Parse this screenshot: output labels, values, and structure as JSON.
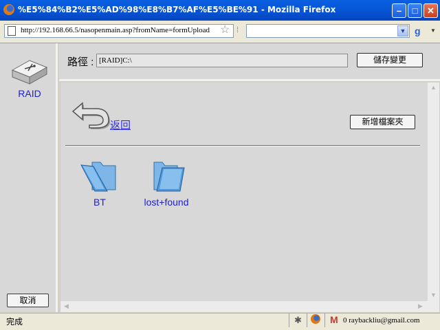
{
  "window": {
    "title": "%E5%84%B2%E5%AD%98%E8%B7%AF%E5%BE%91 - Mozilla Firefox",
    "minimize": "–",
    "maximize": "□",
    "close": "✕"
  },
  "nav": {
    "url": "http://192.168.66.5/nasopenmain.asp?fromName=formUpload"
  },
  "sidebar": {
    "drive_label": "RAID",
    "cancel_label": "取消"
  },
  "toolbar": {
    "path_label": "路徑 :",
    "path_value": "[RAID]C:\\",
    "save_label": "儲存變更"
  },
  "content": {
    "back_label": "返回",
    "new_folder_label": "新增檔案夾",
    "folders": [
      {
        "name": "BT"
      },
      {
        "name": "lost+found"
      }
    ]
  },
  "status": {
    "text": "完成",
    "gmail": "0 raybackliu@gmail.com"
  },
  "colors": {
    "titlebar": "#0758d8",
    "link": "#3030d8",
    "panel": "#d8d8d8"
  }
}
